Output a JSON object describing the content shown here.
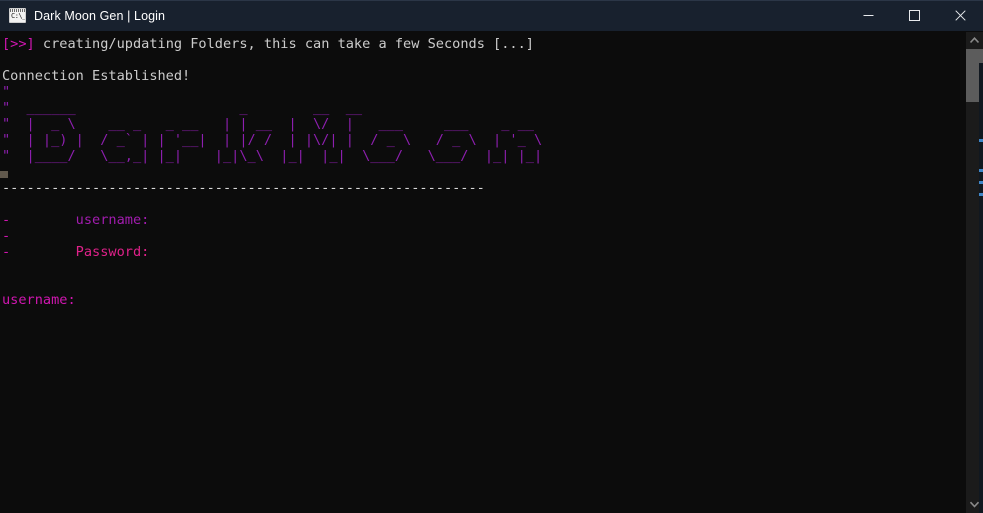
{
  "window": {
    "title": "Dark Moon Gen | Login",
    "icon_name": "cmd-console-icon",
    "icon_text": "C:\\_",
    "controls": {
      "minimize_label": "Minimize",
      "maximize_label": "Maximize",
      "close_label": "Close"
    },
    "colors": {
      "titlebar_bg": "#18212e",
      "terminal_bg": "#0c0c0c",
      "accent_magenta": "#d016b0",
      "accent_pink": "#e0218a",
      "ascii_art_purple": "#8e1fb0",
      "body_text": "#cccccc",
      "scrollbar_thumb": "#5c5c5c",
      "scrollbar_track": "#1b1b1b"
    }
  },
  "terminal": {
    "lines": [
      {
        "id": "status-creating-folders",
        "segments": [
          {
            "text": "[>>]",
            "color": "magenta"
          },
          {
            "text": " creating/updating Folders, this can take a few Seconds [...]",
            "color": "white"
          }
        ]
      },
      {
        "id": "blank-1",
        "segments": [
          {
            "text": " ",
            "color": "white"
          }
        ]
      },
      {
        "id": "status-connection",
        "segments": [
          {
            "text": "Connection Established!",
            "color": "white"
          }
        ]
      },
      {
        "id": "banner-row-1",
        "segments": [
          {
            "text": "\"",
            "color": "art"
          }
        ]
      },
      {
        "id": "banner-row-2",
        "segments": [
          {
            "text": "\"  ______                    _        __  __                       ",
            "color": "art"
          }
        ]
      },
      {
        "id": "banner-row-3",
        "segments": [
          {
            "text": "\"  |  _ \\    __ _   _ __   | | __  |  \\/  |   ___     ___    _ __  ",
            "color": "art"
          }
        ]
      },
      {
        "id": "banner-row-4",
        "segments": [
          {
            "text": "\"  | |_) |  / _` | | '__|  | |/ /  | |\\/| |  / _ \\   / _ \\  | '_ \\ ",
            "color": "art"
          }
        ]
      },
      {
        "id": "banner-row-5",
        "segments": [
          {
            "text": "\"  |____/   \\__,_| |_|    |_|\\_\\  |_|  |_|  \\___/   \\___/  |_| |_| ",
            "color": "art"
          }
        ]
      },
      {
        "id": "blank-2",
        "segments": [
          {
            "text": " ",
            "color": "white"
          }
        ]
      },
      {
        "id": "separator",
        "segments": [
          {
            "text": "-----------------------------------------------------------",
            "color": "sep"
          }
        ]
      },
      {
        "id": "blank-3",
        "segments": [
          {
            "text": " ",
            "color": "white"
          }
        ]
      },
      {
        "id": "field-username",
        "segments": [
          {
            "text": "-",
            "color": "dash"
          },
          {
            "text": "        ",
            "color": "white"
          },
          {
            "text": "username:",
            "color": "violet"
          }
        ]
      },
      {
        "id": "field-gap",
        "segments": [
          {
            "text": "-",
            "color": "dash"
          }
        ]
      },
      {
        "id": "field-password",
        "segments": [
          {
            "text": "-",
            "color": "dash"
          },
          {
            "text": "        ",
            "color": "white"
          },
          {
            "text": "Password:",
            "color": "pink"
          }
        ]
      },
      {
        "id": "blank-4",
        "segments": [
          {
            "text": " ",
            "color": "white"
          }
        ]
      },
      {
        "id": "blank-5",
        "segments": [
          {
            "text": " ",
            "color": "white"
          }
        ]
      },
      {
        "id": "prompt-username",
        "segments": [
          {
            "text": "username:",
            "color": "magenta"
          }
        ]
      }
    ]
  },
  "scrollbar": {
    "up_arrow_name": "scroll-up-arrow",
    "down_arrow_name": "scroll-down-arrow",
    "thumb_name": "scroll-thumb"
  }
}
